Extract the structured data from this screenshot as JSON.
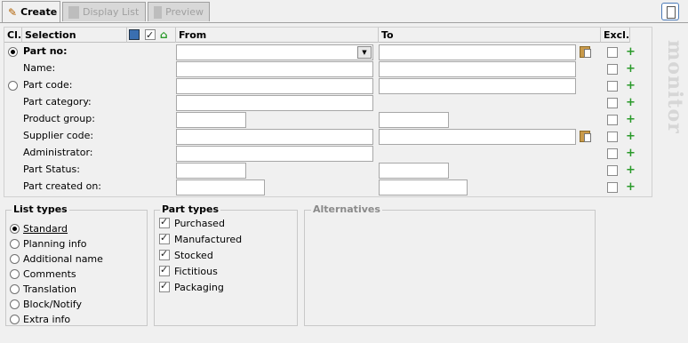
{
  "tabs": [
    {
      "label": "Create",
      "active": true
    },
    {
      "label": "Display List",
      "active": false
    },
    {
      "label": "Preview",
      "active": false
    }
  ],
  "header": {
    "cl": "Cl.",
    "selection": "Selection",
    "from": "From",
    "to": "To",
    "excl": "Excl."
  },
  "rows": [
    {
      "label": "Part no:",
      "bold": true
    },
    {
      "label": "Name:"
    },
    {
      "label": "Part code:"
    },
    {
      "label": "Part category:"
    },
    {
      "label": "Product group:"
    },
    {
      "label": "Supplier code:"
    },
    {
      "label": "Administrator:"
    },
    {
      "label": "Part Status:"
    },
    {
      "label": "Part created on:"
    }
  ],
  "brand": "monitor",
  "list_types": {
    "title": "List types",
    "selected": "Standard",
    "options": [
      "Standard",
      "Planning info",
      "Additional name",
      "Comments",
      "Translation",
      "Block/Notify",
      "Extra info"
    ]
  },
  "part_types": {
    "title": "Part types",
    "options": [
      {
        "label": "Purchased",
        "checked": true
      },
      {
        "label": "Manufactured",
        "checked": true
      },
      {
        "label": "Stocked",
        "checked": true
      },
      {
        "label": "Fictitious",
        "checked": true
      },
      {
        "label": "Packaging",
        "checked": true
      }
    ]
  },
  "alternatives": {
    "title": "Alternatives"
  },
  "colors": {
    "accent_green": "#2a9a2a",
    "border": "#a7a7a7"
  }
}
